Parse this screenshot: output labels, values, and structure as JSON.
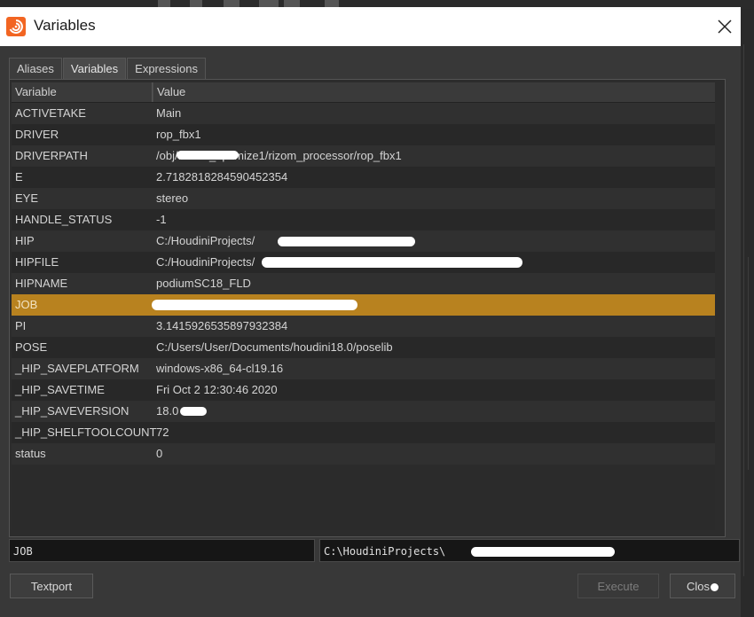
{
  "window": {
    "title": "Variables",
    "icon": "houdini-logo-icon",
    "close_icon": "close-icon"
  },
  "tabs": [
    {
      "label": "Aliases",
      "active": false
    },
    {
      "label": "Variables",
      "active": true
    },
    {
      "label": "Expressions",
      "active": false
    }
  ],
  "table": {
    "headers": {
      "variable": "Variable",
      "value": "Value"
    },
    "rows": [
      {
        "variable": "ACTIVETAKE",
        "value": "Main"
      },
      {
        "variable": "DRIVER",
        "value": "rop_fbx1"
      },
      {
        "variable": "DRIVERPATH",
        "value": "/obj/...muv_optimize1/rizom_processor/rop_fbx1"
      },
      {
        "variable": "E",
        "value": "2.7182818284590452354"
      },
      {
        "variable": "EYE",
        "value": "stereo"
      },
      {
        "variable": "HANDLE_STATUS",
        "value": "-1"
      },
      {
        "variable": "HIP",
        "value": "C:/HoudiniProjects/"
      },
      {
        "variable": "HIPFILE",
        "value": "C:/HoudiniProjects/"
      },
      {
        "variable": "HIPNAME",
        "value": "podiumSC18_FLD"
      },
      {
        "variable": "JOB",
        "value": "",
        "selected": true
      },
      {
        "variable": "PI",
        "value": "3.1415926535897932384"
      },
      {
        "variable": "POSE",
        "value": "C:/Users/User/Documents/houdini18.0/poselib"
      },
      {
        "variable": "_HIP_SAVEPLATFORM",
        "value": "windows-x86_64-cl19.16"
      },
      {
        "variable": "_HIP_SAVETIME",
        "value": "Fri Oct  2 12:30:46 2020"
      },
      {
        "variable": "_HIP_SAVEVERSION",
        "value": "18.0"
      },
      {
        "variable": "_HIP_SHELFTOOLCOUNT",
        "value": "72"
      },
      {
        "variable": "status",
        "value": "0"
      }
    ]
  },
  "edit": {
    "name": "JOB",
    "value": "C:\\HoudiniProjects\\"
  },
  "buttons": {
    "textport": "Textport",
    "execute": "Execute",
    "execute_enabled": false,
    "close": "Clos"
  },
  "colors": {
    "selected_row": "#b8821f",
    "titlebar": "#ffffff",
    "dialog_bg": "#383838",
    "accent_logo": "#f26522"
  }
}
